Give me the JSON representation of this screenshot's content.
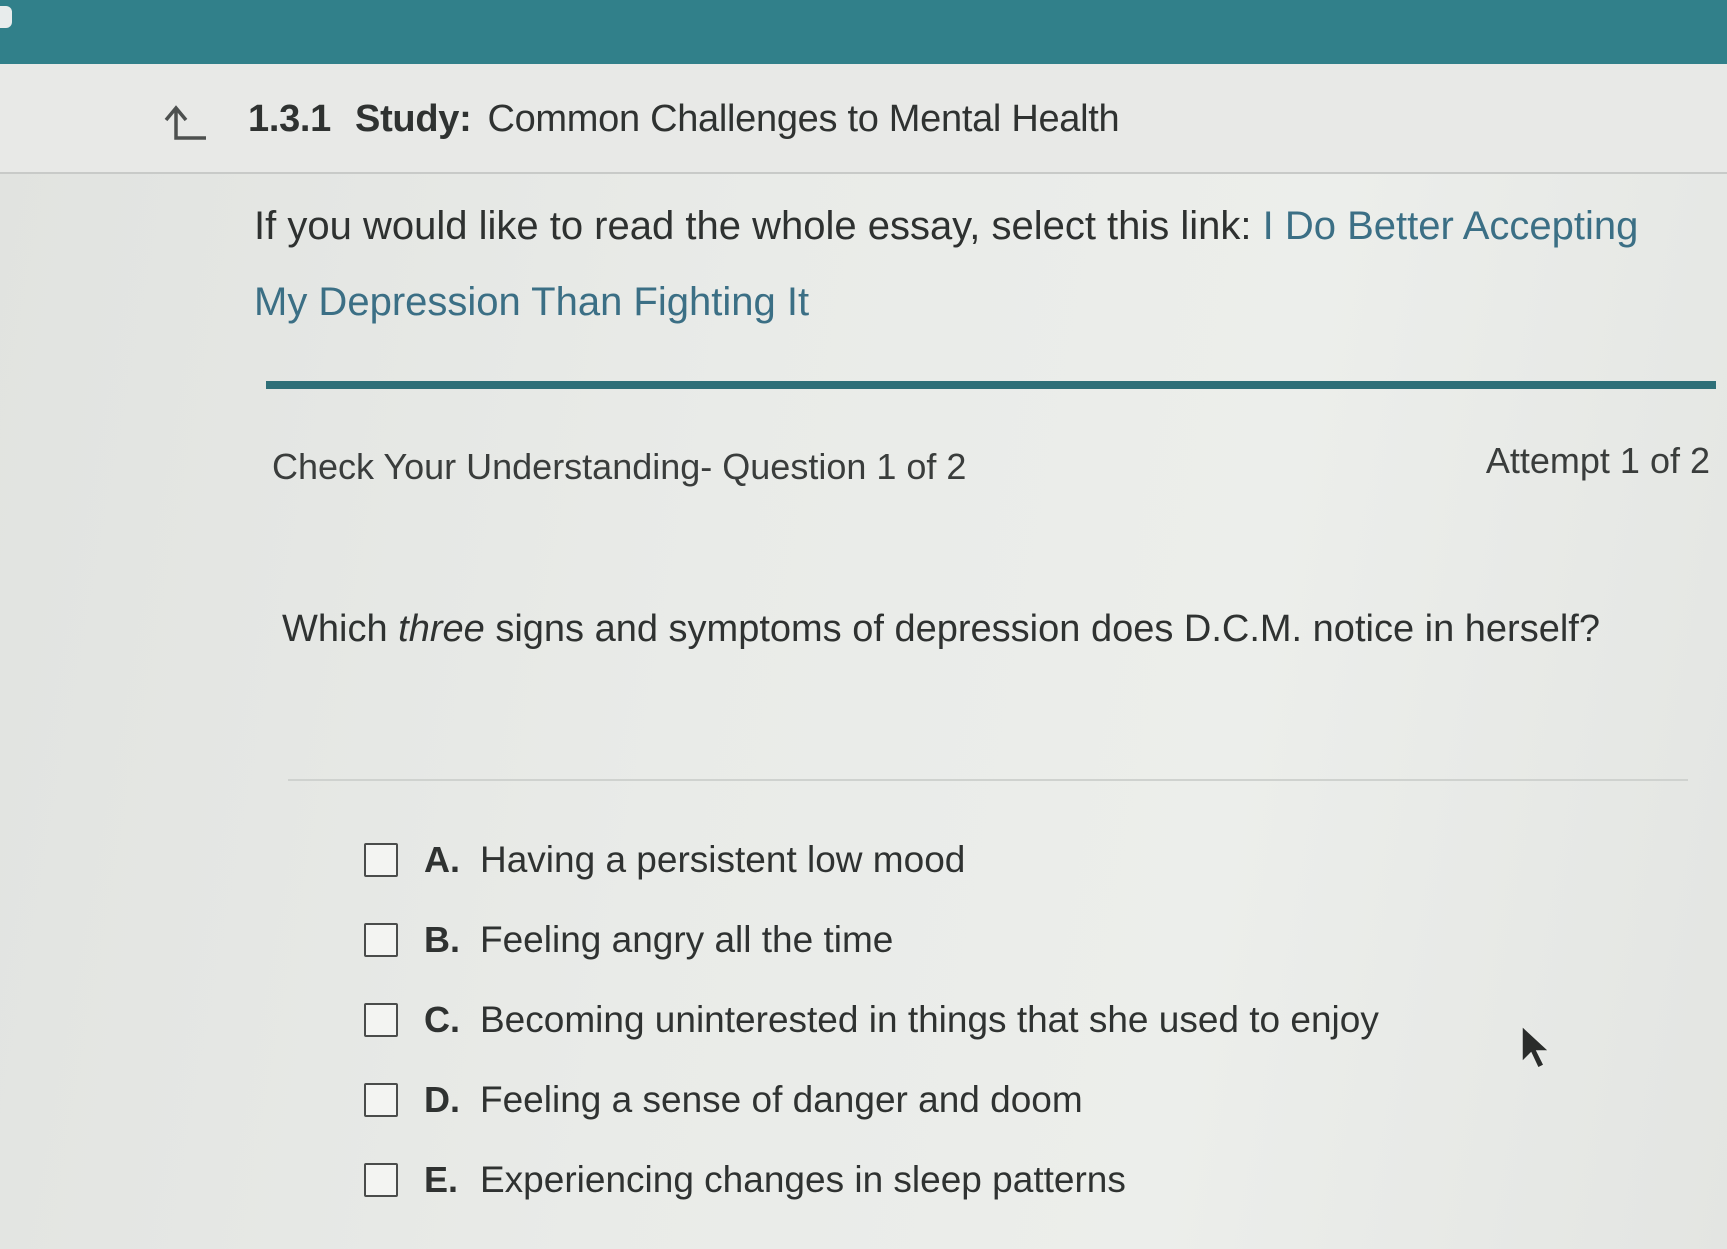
{
  "header": {
    "section_number": "1.3.1",
    "section_kind": "Study:",
    "section_title": "Common Challenges to Mental Health",
    "back_icon": "back-arrow-up-left-icon"
  },
  "intro": {
    "text": "If you would like to read the whole essay, select this link: ",
    "link_text": "I Do Better Accepting My Depression Than Fighting It"
  },
  "quiz": {
    "meta_label": "Check Your Understanding- Question 1 of 2",
    "attempt_label": "Attempt 1 of 2",
    "prompt_before": "Which ",
    "prompt_emphasis": "three",
    "prompt_after": " signs and symptoms of depression does D.C.M. notice in herself?",
    "options": [
      {
        "letter": "A.",
        "text": "Having a persistent low mood",
        "checked": false
      },
      {
        "letter": "B.",
        "text": "Feeling angry all the time",
        "checked": false
      },
      {
        "letter": "C.",
        "text": "Becoming uninterested in things that she used to enjoy",
        "checked": false
      },
      {
        "letter": "D.",
        "text": "Feeling a sense of danger and doom",
        "checked": false
      },
      {
        "letter": "E.",
        "text": "Experiencing changes in sleep patterns",
        "checked": false
      }
    ]
  },
  "colors": {
    "top_bar": "#31808a",
    "divider": "#2e6f78",
    "link": "#3b6f85"
  }
}
